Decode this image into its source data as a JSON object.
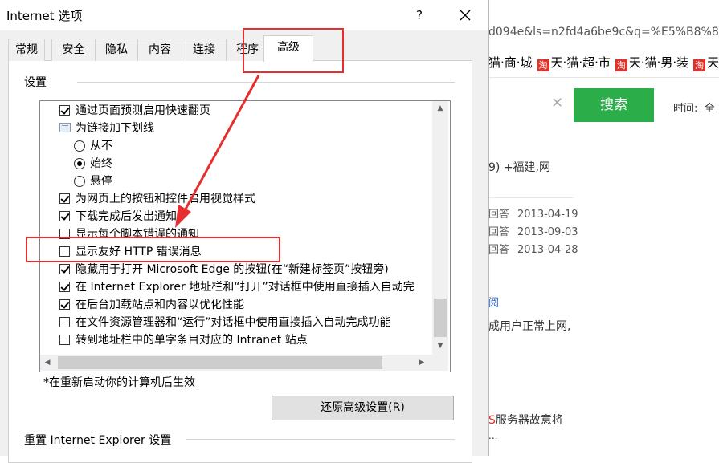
{
  "background": {
    "url_fragment": "d094e&ls=n2fd4a6be9c&q=%E5%B8%8B",
    "favorites": [
      "猫·商·城",
      "天·猫·超·市",
      "天·猫·男·装",
      "天"
    ],
    "favorite_badge": "淘",
    "clear_icon": "close-icon",
    "search_button": "搜索",
    "time_label": "时间:",
    "time_value": "全",
    "result_title": "9) +福建,网",
    "answers": [
      {
        "label": "回答",
        "date": "2013-04-19"
      },
      {
        "label": "回答",
        "date": "2013-09-03"
      },
      {
        "label": "回答",
        "date": "2013-04-28"
      }
    ],
    "link_text": "阅",
    "text_line_1": "成用户正常上网,",
    "text_line_2_prefix": "S",
    "text_line_2": "服务器故意将",
    "text_line_3": "..."
  },
  "dialog": {
    "title": "Internet 选项",
    "help_label": "?",
    "close_icon": "close-icon",
    "tabs": [
      "常规",
      "安全",
      "隐私",
      "内容",
      "连接",
      "程序",
      "高级"
    ],
    "active_tab": "高级",
    "group_label": "设置",
    "settings": [
      {
        "type": "checkbox",
        "checked": true,
        "label": "通过页面预测启用快速翻页"
      },
      {
        "type": "group",
        "label": "为链接加下划线"
      },
      {
        "type": "radio",
        "checked": false,
        "label": "从不"
      },
      {
        "type": "radio",
        "checked": true,
        "label": "始终"
      },
      {
        "type": "radio",
        "checked": false,
        "label": "悬停"
      },
      {
        "type": "checkbox",
        "checked": true,
        "label": "为网页上的按钮和控件启用视觉样式"
      },
      {
        "type": "checkbox",
        "checked": true,
        "label": "下载完成后发出通知"
      },
      {
        "type": "checkbox",
        "checked": false,
        "label": "显示每个脚本错误的通知"
      },
      {
        "type": "checkbox",
        "checked": false,
        "label": "显示友好 HTTP 错误消息"
      },
      {
        "type": "checkbox",
        "checked": true,
        "label": "隐藏用于打开 Microsoft Edge 的按钮(在“新建标签页”按钮旁)"
      },
      {
        "type": "checkbox",
        "checked": true,
        "label": "在 Internet Explorer 地址栏和“打开”对话框中使用直接插入自动完"
      },
      {
        "type": "checkbox",
        "checked": true,
        "label": "在后台加载站点和内容以优化性能"
      },
      {
        "type": "checkbox",
        "checked": false,
        "label": "在文件资源管理器和“运行”对话框中使用直接插入自动完成功能"
      },
      {
        "type": "checkbox",
        "checked": false,
        "label": "转到地址栏中的单字条目对应的 Intranet 站点"
      }
    ],
    "restart_note": "*在重新启动你的计算机后生效",
    "restore_button": "还原高级设置(R)",
    "reset_label": "重置 Internet Explorer 设置",
    "scroll_up_icon": "scroll-up-icon",
    "scroll_down_icon": "scroll-down-icon",
    "scroll_left_icon": "scroll-left-icon",
    "scroll_right_icon": "scroll-right-icon"
  },
  "colors": {
    "annotation": "#e62e2e",
    "search_green": "#2bae4a",
    "badge_red": "#e0312a"
  }
}
